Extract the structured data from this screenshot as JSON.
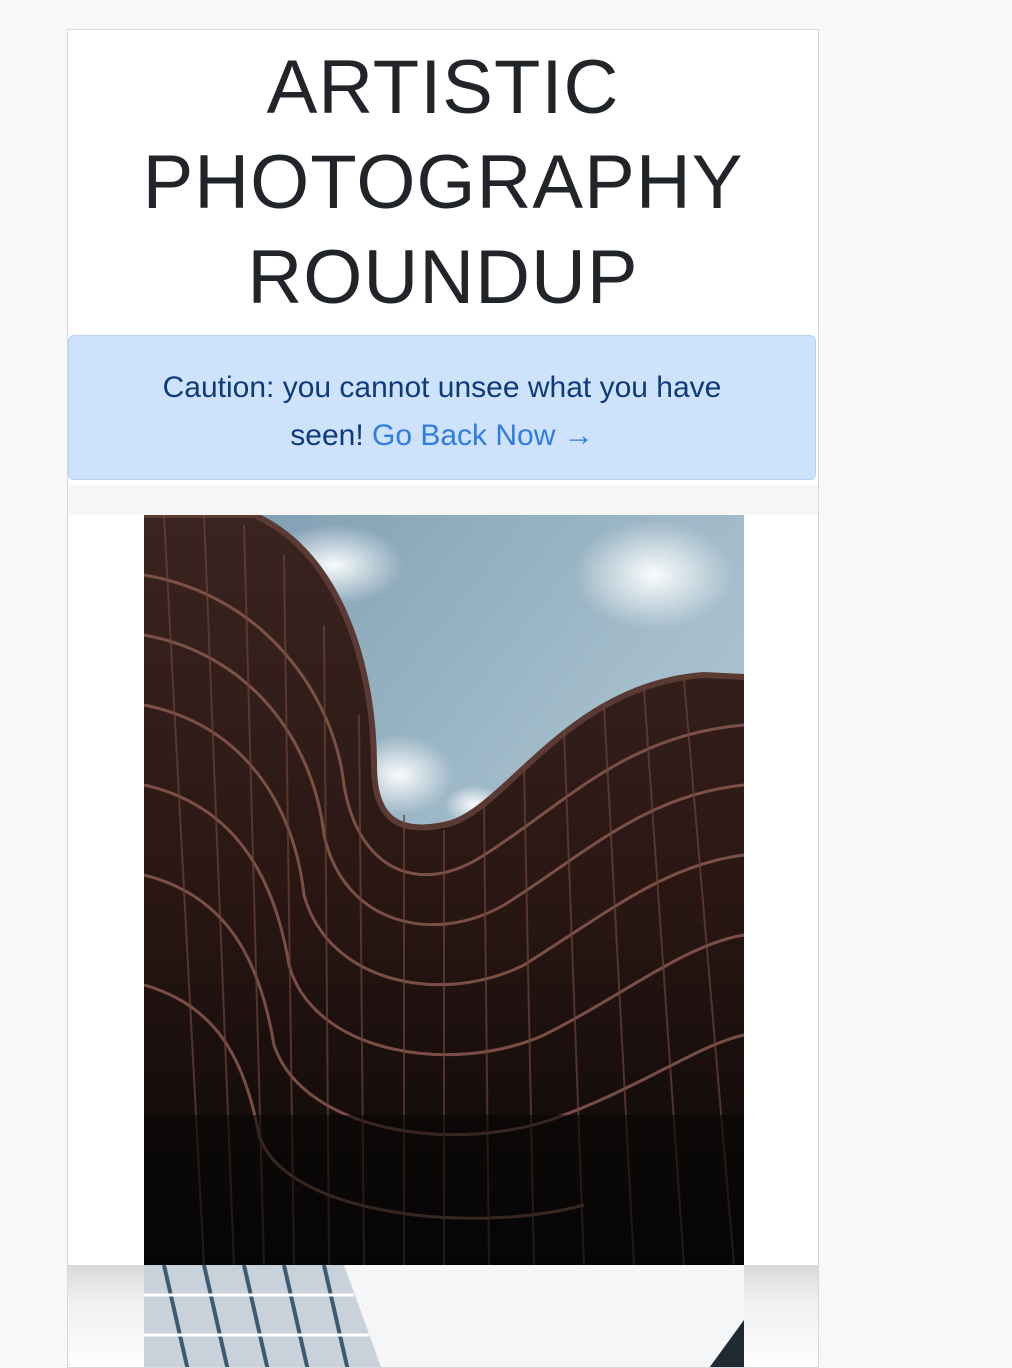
{
  "header": {
    "title_line1": "ARTISTIC",
    "title_line2": "PHOTOGRAPHY",
    "title_line3": "ROUNDUP"
  },
  "alert": {
    "text": "Caution: you cannot unsee what you have seen!",
    "link_label": "Go Back Now →"
  },
  "colors": {
    "alert_bg": "#cfe2fb",
    "alert_text": "#0d3b79",
    "link": "#2f7ce2",
    "title": "#212529"
  },
  "gallery": {
    "items": [
      {
        "icon": "architecture-photo"
      },
      {
        "icon": "building-photo"
      }
    ]
  }
}
